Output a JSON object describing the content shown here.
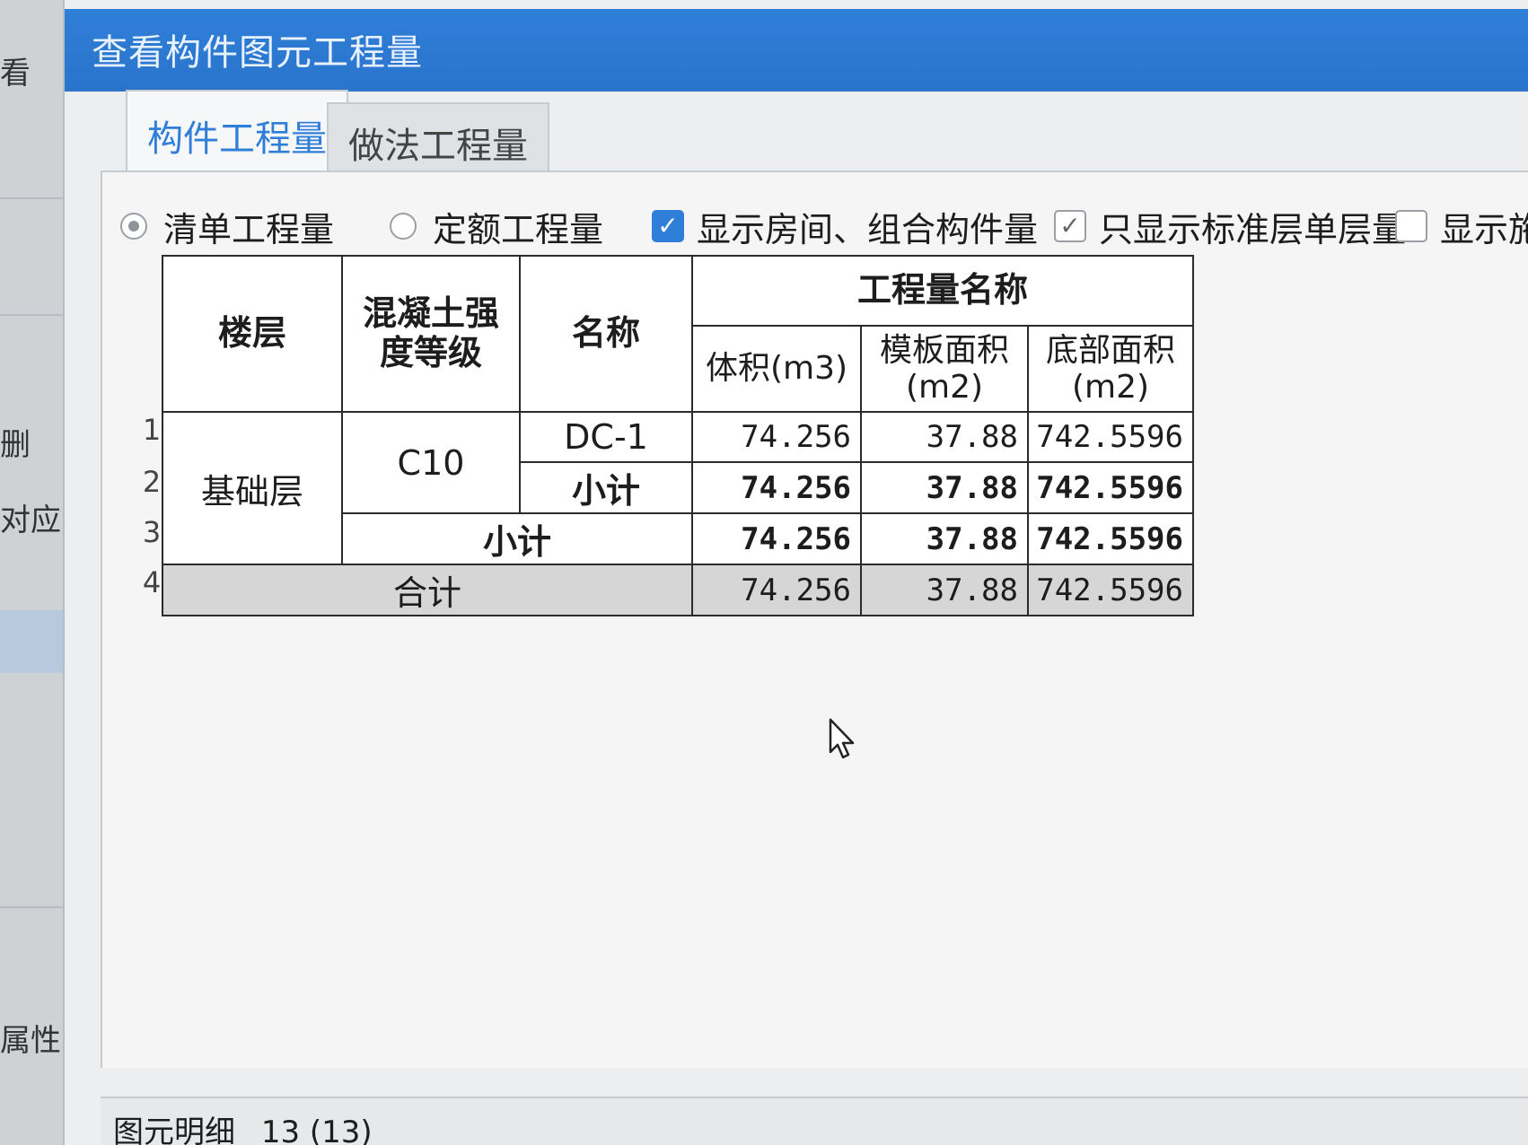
{
  "background": {
    "left_fragments": [
      "看",
      "删",
      "对应",
      "属性"
    ]
  },
  "dialog": {
    "title": "查看构件图元工程量",
    "tabs": [
      {
        "label": "构件工程量",
        "active": true
      },
      {
        "label": "做法工程量",
        "active": false
      }
    ],
    "options": {
      "qingdan": {
        "label": "清单工程量",
        "selected": true
      },
      "dinge": {
        "label": "定额工程量",
        "selected": false
      },
      "show_room": {
        "label": "显示房间、组合构件量",
        "checked": true
      },
      "std_layer": {
        "label": "只显示标准层单层量",
        "checked": true
      },
      "show_construction": {
        "label": "显示施",
        "checked": false
      }
    },
    "table": {
      "headers": {
        "floor": "楼层",
        "grade": "混凝土强度等级",
        "name": "名称",
        "group": "工程量名称",
        "volume": "体积(m3)",
        "formwork": "模板面积(m2)",
        "bottom": "底部面积(m2)"
      },
      "row_numbers": [
        "1",
        "2",
        "3",
        "4"
      ],
      "floor_value": "基础层",
      "grade_value": "C10",
      "rows": [
        {
          "name": "DC-1",
          "volume": "74.256",
          "formwork": "37.88",
          "bottom": "742.5596"
        },
        {
          "name": "小计",
          "volume": "74.256",
          "formwork": "37.88",
          "bottom": "742.5596"
        },
        {
          "name": "小计",
          "volume": "74.256",
          "formwork": "37.88",
          "bottom": "742.5596"
        },
        {
          "name": "合计",
          "volume": "74.256",
          "formwork": "37.88",
          "bottom": "742.5596"
        }
      ]
    },
    "status": {
      "label": "图元明细",
      "count": "13 (13)"
    }
  }
}
